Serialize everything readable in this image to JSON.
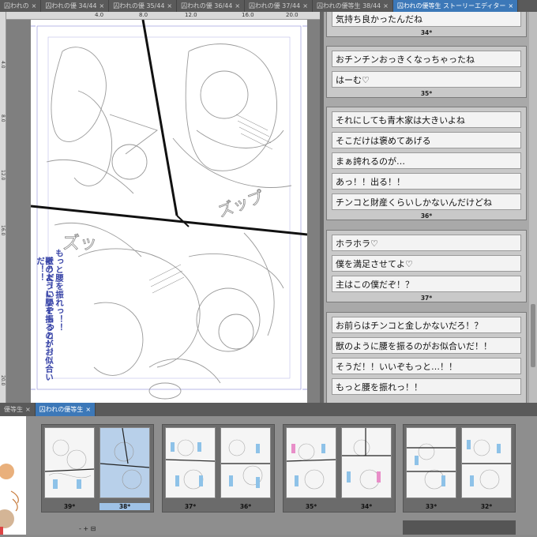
{
  "tabs": [
    {
      "label": "囚われの",
      "close": "×"
    },
    {
      "label": "囚われの優 34/44",
      "close": "×"
    },
    {
      "label": "囚われの優 35/44",
      "close": "×"
    },
    {
      "label": "囚われの優 36/44",
      "close": "×"
    },
    {
      "label": "囚われの優 37/44",
      "close": "×"
    },
    {
      "label": "囚われの優等生 38/44",
      "close": "×"
    },
    {
      "label": "囚われの優等生 ストーリーエディター",
      "close": "×"
    }
  ],
  "ruler_top": [
    "4.0",
    "8.0",
    "12.0",
    "16.0",
    "20.0"
  ],
  "ruler_left": [
    "4.0",
    "8.0",
    "12.0",
    "16.0",
    "20.0"
  ],
  "page_vertical_text": [
    "もっと腰を振れっ！！",
    "そうだ！いいぞもっと…！",
    "獣のように腰を振るのがお似合いだ！！"
  ],
  "page_sfx": [
    "ズッ",
    "ズップ"
  ],
  "story_groups": [
    {
      "lines": [
        "気持ち良かったんだね"
      ],
      "page": "34*"
    },
    {
      "lines": [
        "おチンチンおっきくなっちゃったね",
        "はーむ♡"
      ],
      "page": "35*"
    },
    {
      "lines": [
        "それにしても青木家は大きいよね",
        "そこだけは褒めてあげる",
        "まぁ誇れるのが…",
        "あっ！！出る！！",
        "チンコと財産くらいしかないんだけどね"
      ],
      "page": "36*"
    },
    {
      "lines": [
        "ホラホラ♡",
        "僕を満足させてよ♡",
        "主はこの僕だぞ！？"
      ],
      "page": "37*"
    },
    {
      "lines": [
        "お前らはチンコと金しかないだろ！？",
        "獣のように腰を振るのがお似合いだ！！",
        "そうだ！！いいぞもっと…！！",
        "もっと腰を振れっ！！"
      ],
      "page": ""
    }
  ],
  "bottom_tabs": [
    {
      "label": "優等生",
      "close": "×"
    },
    {
      "label": "囚われの優等生",
      "close": "×"
    }
  ],
  "thumbnails": [
    {
      "left": "39*",
      "right": "38*"
    },
    {
      "left": "37*",
      "right": "36*"
    },
    {
      "left": "35*",
      "right": "34*"
    },
    {
      "left": "33*",
      "right": "32*"
    }
  ],
  "bottom_toolbar": "- + ⊟"
}
